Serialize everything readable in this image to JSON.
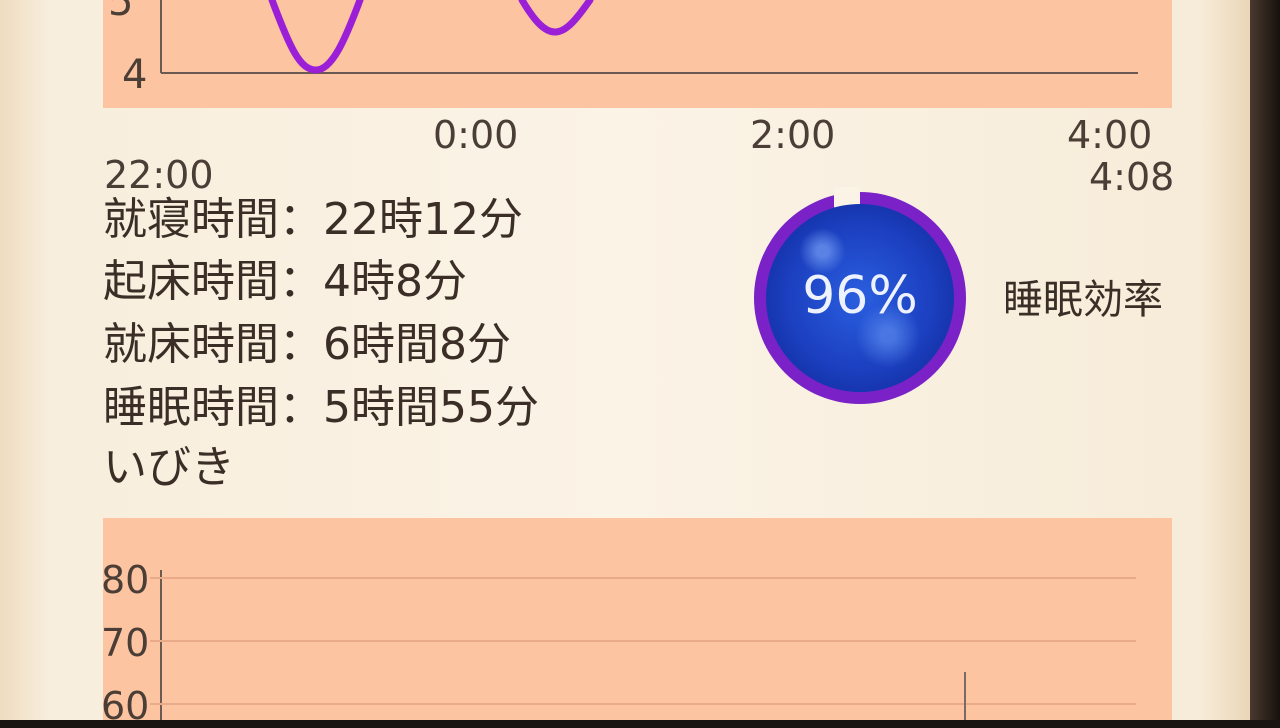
{
  "sleep_chart": {
    "y_ticks": [
      "4"
    ],
    "x_ticks": [
      "22:00",
      "0:00",
      "2:00",
      "4:00"
    ],
    "end_time": "4:08",
    "line_color": "#9b1fd6"
  },
  "summary": {
    "bedtime": "就寝時間：22時12分",
    "wake_time": "起床時間：4時8分",
    "time_in_bed": "就床時間：6時間8分",
    "sleep_time": "睡眠時間：5時間55分"
  },
  "efficiency": {
    "value": "96%",
    "label": "睡眠効率",
    "ring_color": "#7a22c8",
    "fraction": 0.96
  },
  "snore": {
    "title": "いびき",
    "y_ticks": [
      "80",
      "70",
      "60"
    ]
  },
  "colors": {
    "panel": "#fcc4a0",
    "paper": "#fbf3e6"
  }
}
